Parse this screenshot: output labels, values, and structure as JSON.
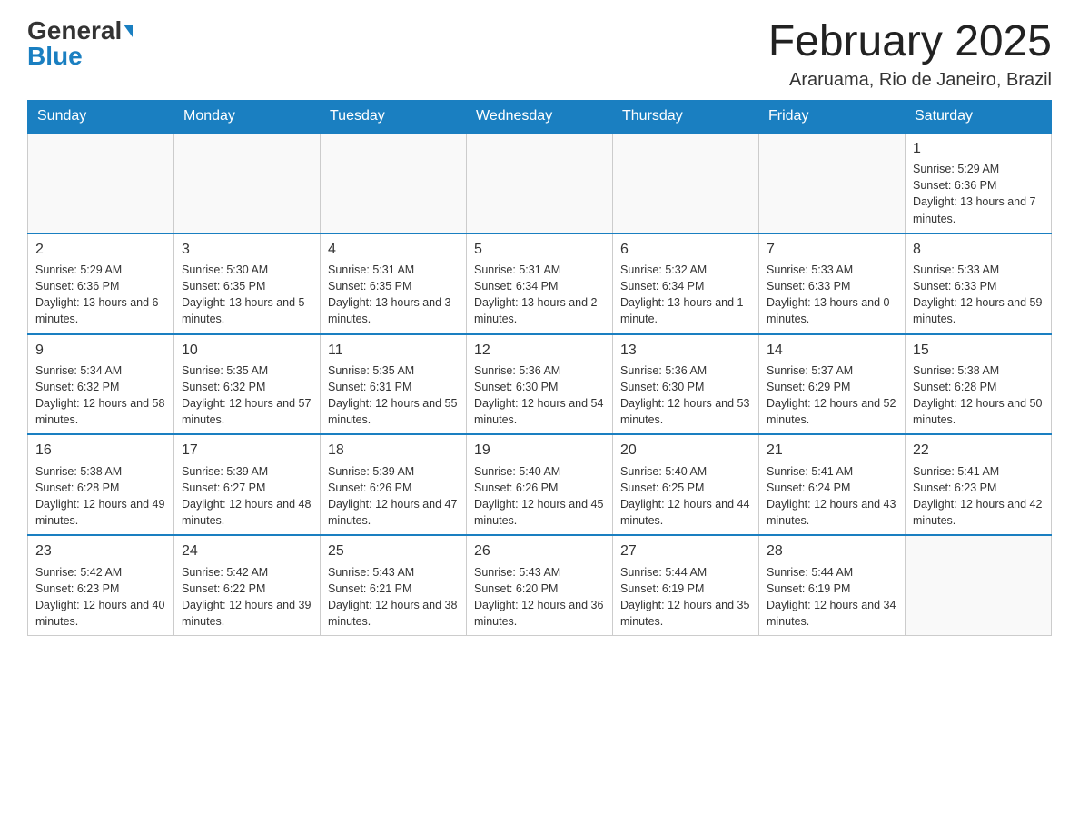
{
  "header": {
    "logo_general": "General",
    "logo_blue": "Blue",
    "title": "February 2025",
    "subtitle": "Araruama, Rio de Janeiro, Brazil"
  },
  "weekdays": [
    "Sunday",
    "Monday",
    "Tuesday",
    "Wednesday",
    "Thursday",
    "Friday",
    "Saturday"
  ],
  "weeks": [
    [
      {
        "day": "",
        "info": ""
      },
      {
        "day": "",
        "info": ""
      },
      {
        "day": "",
        "info": ""
      },
      {
        "day": "",
        "info": ""
      },
      {
        "day": "",
        "info": ""
      },
      {
        "day": "",
        "info": ""
      },
      {
        "day": "1",
        "info": "Sunrise: 5:29 AM\nSunset: 6:36 PM\nDaylight: 13 hours and 7 minutes."
      }
    ],
    [
      {
        "day": "2",
        "info": "Sunrise: 5:29 AM\nSunset: 6:36 PM\nDaylight: 13 hours and 6 minutes."
      },
      {
        "day": "3",
        "info": "Sunrise: 5:30 AM\nSunset: 6:35 PM\nDaylight: 13 hours and 5 minutes."
      },
      {
        "day": "4",
        "info": "Sunrise: 5:31 AM\nSunset: 6:35 PM\nDaylight: 13 hours and 3 minutes."
      },
      {
        "day": "5",
        "info": "Sunrise: 5:31 AM\nSunset: 6:34 PM\nDaylight: 13 hours and 2 minutes."
      },
      {
        "day": "6",
        "info": "Sunrise: 5:32 AM\nSunset: 6:34 PM\nDaylight: 13 hours and 1 minute."
      },
      {
        "day": "7",
        "info": "Sunrise: 5:33 AM\nSunset: 6:33 PM\nDaylight: 13 hours and 0 minutes."
      },
      {
        "day": "8",
        "info": "Sunrise: 5:33 AM\nSunset: 6:33 PM\nDaylight: 12 hours and 59 minutes."
      }
    ],
    [
      {
        "day": "9",
        "info": "Sunrise: 5:34 AM\nSunset: 6:32 PM\nDaylight: 12 hours and 58 minutes."
      },
      {
        "day": "10",
        "info": "Sunrise: 5:35 AM\nSunset: 6:32 PM\nDaylight: 12 hours and 57 minutes."
      },
      {
        "day": "11",
        "info": "Sunrise: 5:35 AM\nSunset: 6:31 PM\nDaylight: 12 hours and 55 minutes."
      },
      {
        "day": "12",
        "info": "Sunrise: 5:36 AM\nSunset: 6:30 PM\nDaylight: 12 hours and 54 minutes."
      },
      {
        "day": "13",
        "info": "Sunrise: 5:36 AM\nSunset: 6:30 PM\nDaylight: 12 hours and 53 minutes."
      },
      {
        "day": "14",
        "info": "Sunrise: 5:37 AM\nSunset: 6:29 PM\nDaylight: 12 hours and 52 minutes."
      },
      {
        "day": "15",
        "info": "Sunrise: 5:38 AM\nSunset: 6:28 PM\nDaylight: 12 hours and 50 minutes."
      }
    ],
    [
      {
        "day": "16",
        "info": "Sunrise: 5:38 AM\nSunset: 6:28 PM\nDaylight: 12 hours and 49 minutes."
      },
      {
        "day": "17",
        "info": "Sunrise: 5:39 AM\nSunset: 6:27 PM\nDaylight: 12 hours and 48 minutes."
      },
      {
        "day": "18",
        "info": "Sunrise: 5:39 AM\nSunset: 6:26 PM\nDaylight: 12 hours and 47 minutes."
      },
      {
        "day": "19",
        "info": "Sunrise: 5:40 AM\nSunset: 6:26 PM\nDaylight: 12 hours and 45 minutes."
      },
      {
        "day": "20",
        "info": "Sunrise: 5:40 AM\nSunset: 6:25 PM\nDaylight: 12 hours and 44 minutes."
      },
      {
        "day": "21",
        "info": "Sunrise: 5:41 AM\nSunset: 6:24 PM\nDaylight: 12 hours and 43 minutes."
      },
      {
        "day": "22",
        "info": "Sunrise: 5:41 AM\nSunset: 6:23 PM\nDaylight: 12 hours and 42 minutes."
      }
    ],
    [
      {
        "day": "23",
        "info": "Sunrise: 5:42 AM\nSunset: 6:23 PM\nDaylight: 12 hours and 40 minutes."
      },
      {
        "day": "24",
        "info": "Sunrise: 5:42 AM\nSunset: 6:22 PM\nDaylight: 12 hours and 39 minutes."
      },
      {
        "day": "25",
        "info": "Sunrise: 5:43 AM\nSunset: 6:21 PM\nDaylight: 12 hours and 38 minutes."
      },
      {
        "day": "26",
        "info": "Sunrise: 5:43 AM\nSunset: 6:20 PM\nDaylight: 12 hours and 36 minutes."
      },
      {
        "day": "27",
        "info": "Sunrise: 5:44 AM\nSunset: 6:19 PM\nDaylight: 12 hours and 35 minutes."
      },
      {
        "day": "28",
        "info": "Sunrise: 5:44 AM\nSunset: 6:19 PM\nDaylight: 12 hours and 34 minutes."
      },
      {
        "day": "",
        "info": ""
      }
    ]
  ]
}
